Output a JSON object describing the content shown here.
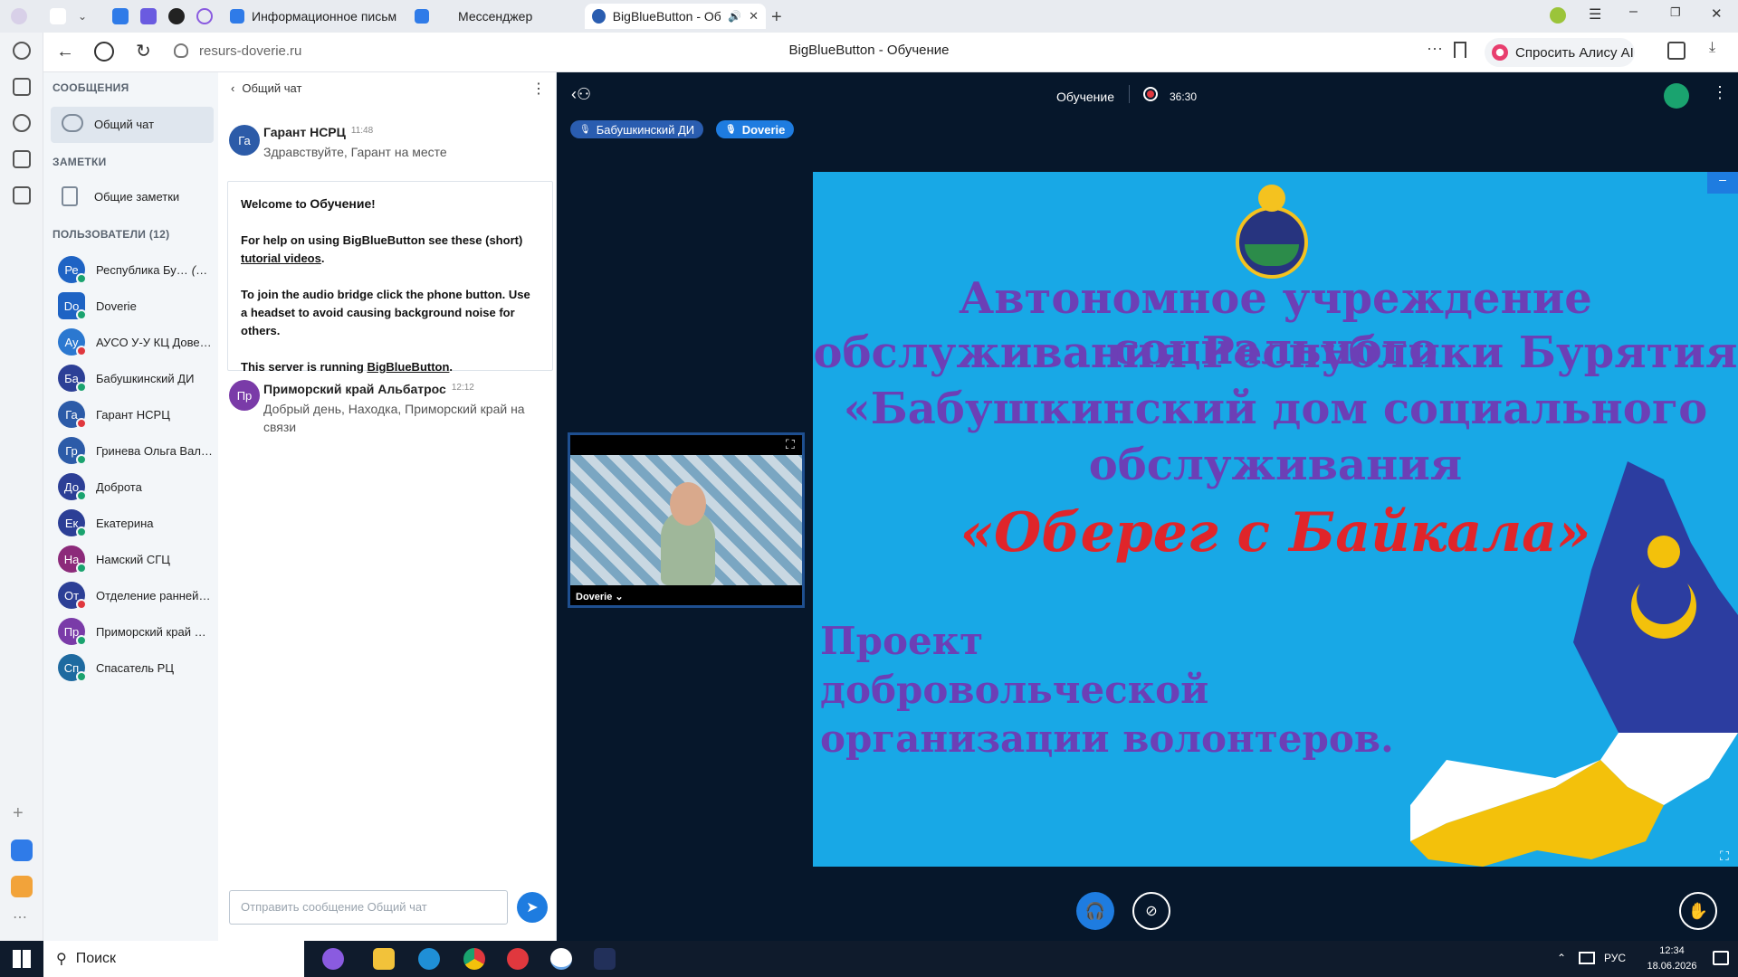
{
  "browser": {
    "tabs": [
      {
        "label": "Информационное письм"
      },
      {
        "label": "Мессенджер"
      },
      {
        "label": "BigBlueButton - Обу"
      }
    ],
    "url": "resurs-doverie.ru",
    "page_title": "BigBlueButton - Обучение",
    "alice_label": "Спросить Алису AI"
  },
  "sidebar": {
    "messages_title": "СООБЩЕНИЯ",
    "public_chat": "Общий чат",
    "notes_title": "ЗАМЕТКИ",
    "shared_notes": "Общие заметки",
    "users_title": "ПОЛЬЗОВАТЕЛИ (12)",
    "users": [
      {
        "initials": "Ре",
        "name": "Республика Бу…",
        "you": "(Вы)",
        "color": "#1e63c4",
        "mic": "#1aa36f"
      },
      {
        "initials": "Do",
        "name": "Doverie",
        "you": "",
        "color": "#1e63c4",
        "mic": "#1aa36f"
      },
      {
        "initials": "Ау",
        "name": "АУСО У-У КЦ Довер…",
        "you": "",
        "color": "#2b78d0",
        "mic": "#e0383e"
      },
      {
        "initials": "Ба",
        "name": "Бабушкинский ДИ",
        "you": "",
        "color": "#2c3f96",
        "mic": "#1aa36f"
      },
      {
        "initials": "Га",
        "name": "Гарант НСРЦ",
        "you": "",
        "color": "#2c5ba8",
        "mic": "#e0383e"
      },
      {
        "initials": "Гр",
        "name": "Гринева Ольга Вал…",
        "you": "",
        "color": "#2c5ba8",
        "mic": "#1aa36f"
      },
      {
        "initials": "До",
        "name": "Доброта",
        "you": "",
        "color": "#2c3f96",
        "mic": "#1aa36f"
      },
      {
        "initials": "Ек",
        "name": "Екатерина",
        "you": "",
        "color": "#2c3f96",
        "mic": "#1aa36f"
      },
      {
        "initials": "На",
        "name": "Намский СГЦ",
        "you": "",
        "color": "#8c2a7a",
        "mic": "#1aa36f"
      },
      {
        "initials": "От",
        "name": "Отделение ранней …",
        "you": "",
        "color": "#2c3f96",
        "mic": "#e0383e"
      },
      {
        "initials": "Пр",
        "name": "Приморский край А…",
        "you": "",
        "color": "#7a3ba8",
        "mic": "#1aa36f"
      },
      {
        "initials": "Сп",
        "name": "Спасатель РЦ",
        "you": "",
        "color": "#1e6aa0",
        "mic": "#1aa36f"
      }
    ]
  },
  "chat": {
    "header": "Общий чат",
    "messages": [
      {
        "initials": "Га",
        "author": "Гарант НСРЦ",
        "time": "11:48",
        "text": "Здравствуйте, Гарант на месте",
        "color": "#2c5ba8"
      },
      {
        "initials": "Пр",
        "author": "Приморский край Альбатрос",
        "time": "12:12",
        "text": "Добрый день, Находка, Приморский край на связи",
        "color": "#7a3ba8"
      }
    ],
    "welcome": {
      "line1a": "Welcome to ",
      "line1b": "Обучение",
      "line1c": "!",
      "line2a": "For help on using BigBlueButton see these (short) ",
      "line2link": "tutorial videos",
      "line2b": ".",
      "line3": "To join the audio bridge click the phone button. Use a headset to avoid causing background noise for others.",
      "line4a": "This server is running ",
      "line4link": "BigBlueButton",
      "line4b": "."
    },
    "input_placeholder": "Отправить сообщение Общий чат"
  },
  "meeting": {
    "title": "Обучение",
    "timer": "36:30",
    "talkers": [
      "Бабушкинский ДИ",
      "Doverie"
    ],
    "webcam_name": "Doverie"
  },
  "slide": {
    "line1": "Автономное учреждение социального",
    "line2": "обслуживания Республики Бурятия",
    "line3": "«Бабушкинский дом социального",
    "line4": "обслуживания",
    "highlight": "«Оберег с Байкала»",
    "project1": "Проект",
    "project2": "добровольческой",
    "project3": "организации волонтеров."
  },
  "taskbar": {
    "search": "Поиск",
    "lang": "РУС",
    "time": "12:34",
    "date": "18.06.2026"
  }
}
